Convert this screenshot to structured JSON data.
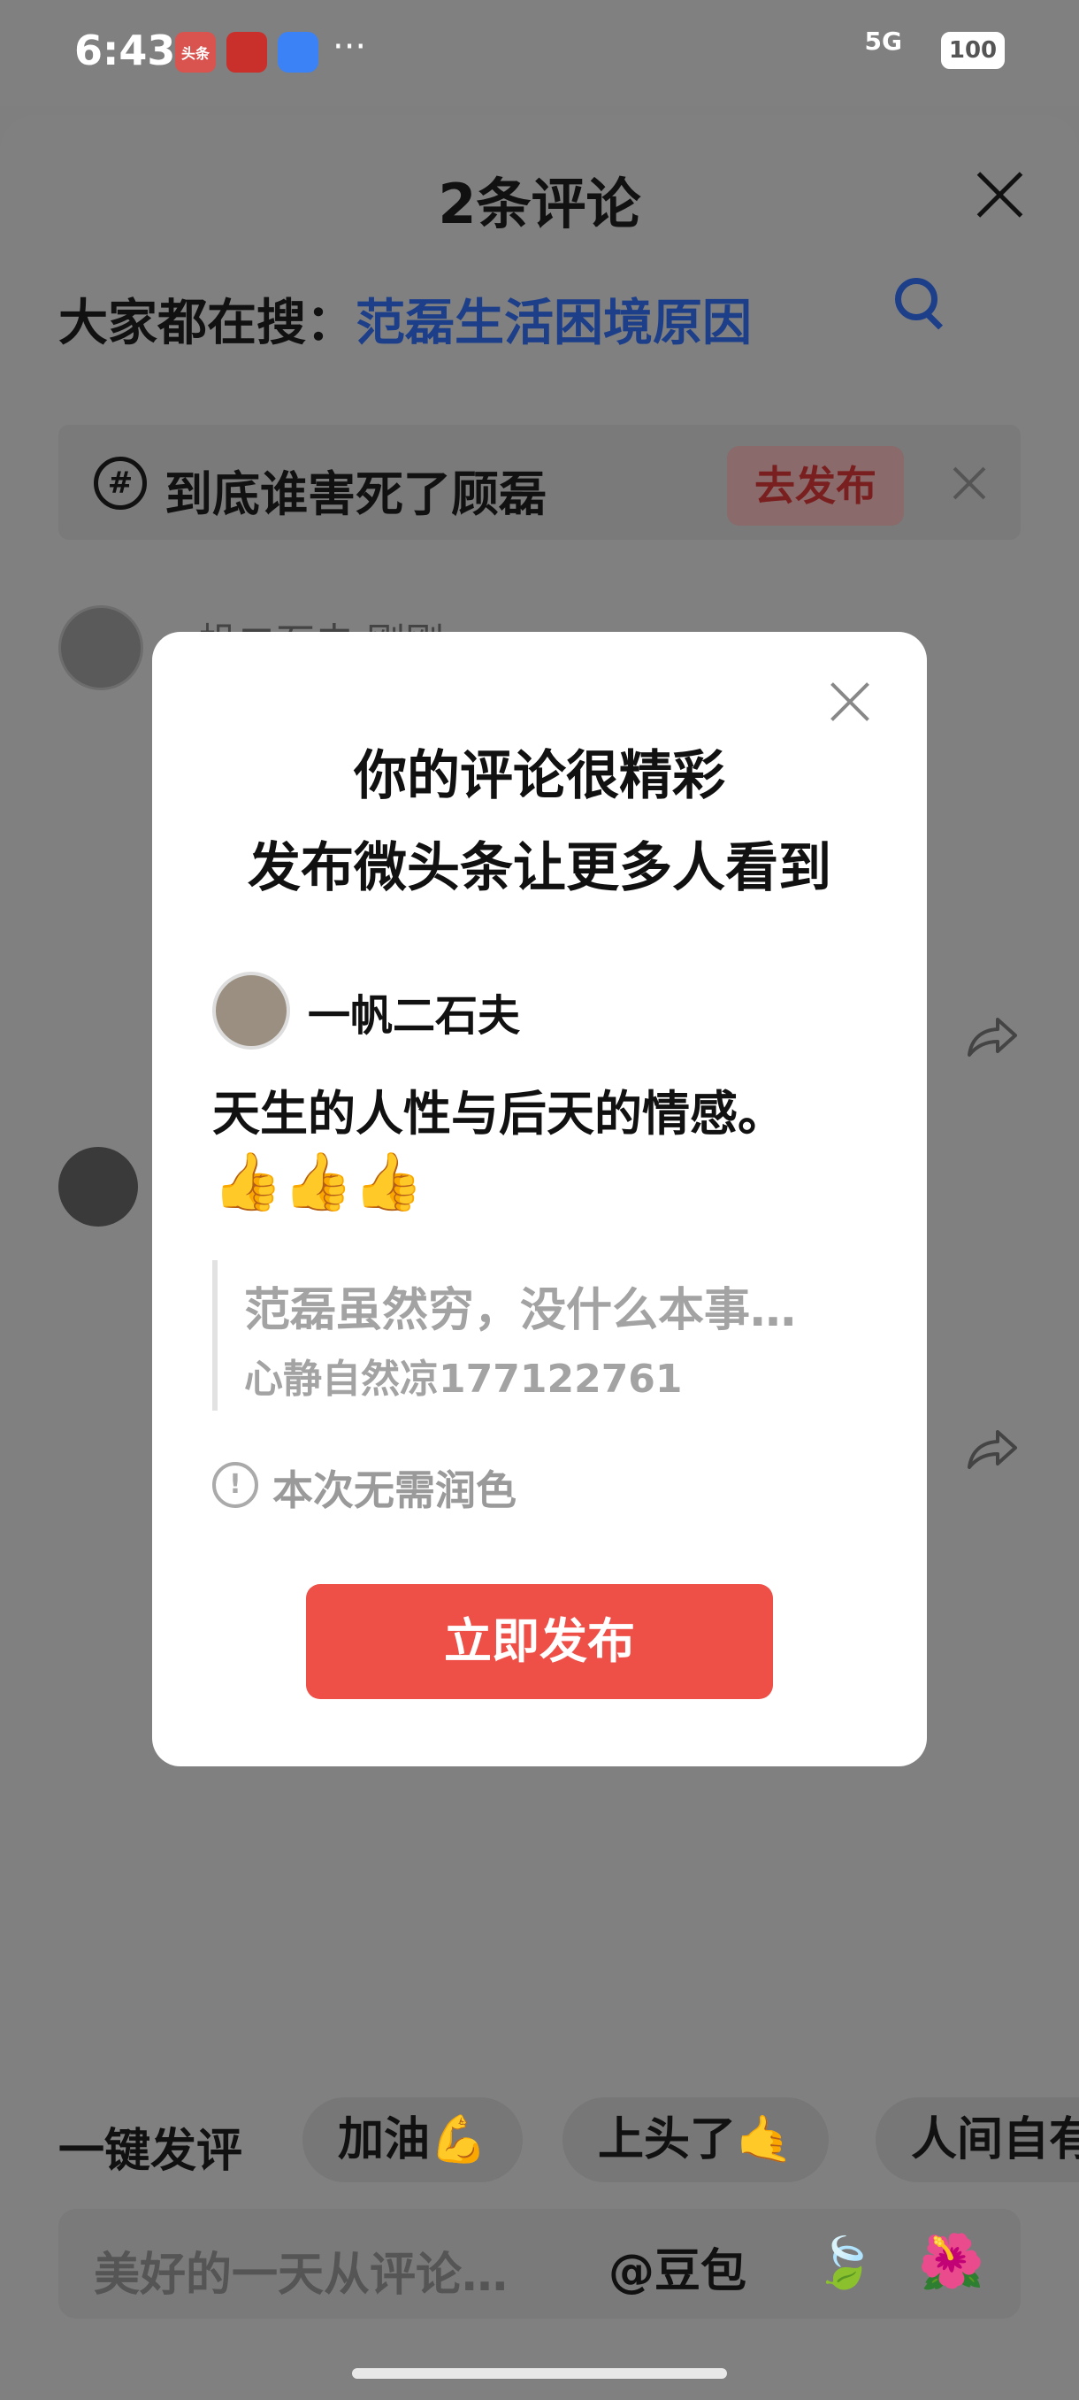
{
  "status_bar": {
    "time": "6:43",
    "app1": "头条",
    "dots": "···",
    "signal": "5G",
    "battery": "100"
  },
  "sheet": {
    "title": "2条评论",
    "search_prefix": "大家都在搜：",
    "search_term": "范磊生活困境原因",
    "topic": "到底谁害死了顾磊",
    "topic_button": "去发布",
    "bg_username": "一帆二石夫 刚刚"
  },
  "modal": {
    "heading_line1": "你的评论很精彩",
    "heading_line2": "发布微头条让更多人看到",
    "username": "一帆二石夫",
    "comment": "天生的人性与后天的情感。",
    "emojis": "👍👍👍",
    "quote_text": "范磊虽然穷，没什么本事…",
    "quote_source": "心静自然凉177122761",
    "info_icon": "!",
    "info": "本次无需润色",
    "publish_button": "立即发布"
  },
  "bottom": {
    "quick_label": "一键发评",
    "chips": [
      "加油💪",
      "上头了🤙",
      "人间自有"
    ],
    "input_placeholder": "美好的一天从评论…",
    "at_doubao": "@豆包"
  }
}
